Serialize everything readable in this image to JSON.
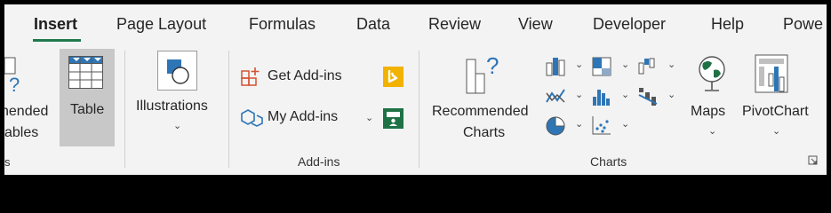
{
  "tabs": [
    {
      "label": "Insert",
      "active": true
    },
    {
      "label": "Page Layout"
    },
    {
      "label": "Formulas"
    },
    {
      "label": "Data"
    },
    {
      "label": "Review"
    },
    {
      "label": "View"
    },
    {
      "label": "Developer"
    },
    {
      "label": "Help"
    },
    {
      "label": "Powe"
    }
  ],
  "tables_group": {
    "recommended_line1": "nended",
    "recommended_line2": "ables",
    "table_label": "Table",
    "group_label_fragment": "s"
  },
  "illustrations": {
    "label": "Illustrations"
  },
  "addins_group": {
    "get_addins": "Get Add-ins",
    "my_addins": "My Add-ins",
    "group_label": "Add-ins"
  },
  "charts_group": {
    "recommended_line1": "Recommended",
    "recommended_line2": "Charts",
    "maps": "Maps",
    "pivotchart": "PivotChart",
    "group_label": "Charts"
  },
  "colors": {
    "accent_green": "#1f7a4c",
    "chart_blue": "#2e75b6",
    "addin_orange": "#d35230",
    "bing_yellow": "#f2b200",
    "people_green": "#1e7145"
  },
  "icons": [
    "pivot-table-icon",
    "table-icon",
    "shapes-icon",
    "get-addins-icon",
    "bing-icon",
    "my-addins-icon",
    "people-graph-icon",
    "recommended-charts-icon",
    "column-chart-icon",
    "hierarchy-chart-icon",
    "waterfall-chart-icon",
    "line-chart-icon",
    "statistic-chart-icon",
    "combo-chart-icon",
    "pie-chart-icon",
    "scatter-chart-icon",
    "maps-icon",
    "pivotchart-icon",
    "dialog-launcher-icon"
  ]
}
